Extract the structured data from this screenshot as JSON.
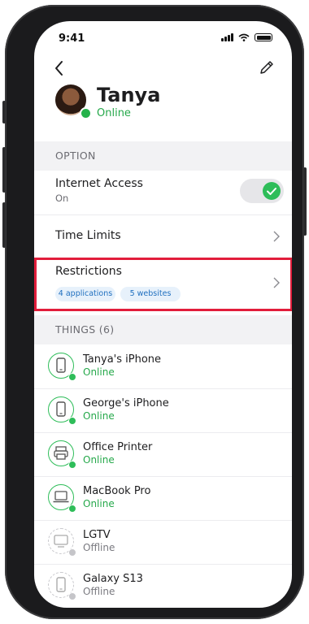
{
  "status_bar": {
    "time": "9:41"
  },
  "profile": {
    "name": "Tanya",
    "status": "Online"
  },
  "sections": {
    "option": "OPTION",
    "things": "THINGS (6)"
  },
  "options": {
    "internet_access": {
      "title": "Internet Access",
      "sub": "On",
      "toggle_on": true
    },
    "time_limits": {
      "title": "Time Limits"
    },
    "restrictions": {
      "title": "Restrictions",
      "tags": [
        "4 applications",
        "5 websites"
      ]
    }
  },
  "things": [
    {
      "name": "Tanya's iPhone",
      "status": "Online",
      "icon": "phone-icon",
      "online": true
    },
    {
      "name": "George's iPhone",
      "status": "Online",
      "icon": "phone-icon",
      "online": true
    },
    {
      "name": "Office Printer",
      "status": "Online",
      "icon": "printer-icon",
      "online": true
    },
    {
      "name": "MacBook Pro",
      "status": "Online",
      "icon": "laptop-icon",
      "online": true
    },
    {
      "name": "LGTV",
      "status": "Offline",
      "icon": "tv-icon",
      "online": false
    },
    {
      "name": "Galaxy S13",
      "status": "Offline",
      "icon": "phone-icon",
      "online": false
    }
  ],
  "colors": {
    "accent_green": "#2ebd59",
    "highlight_red": "#e21d3b",
    "tag_blue": "#1f6fbf"
  }
}
